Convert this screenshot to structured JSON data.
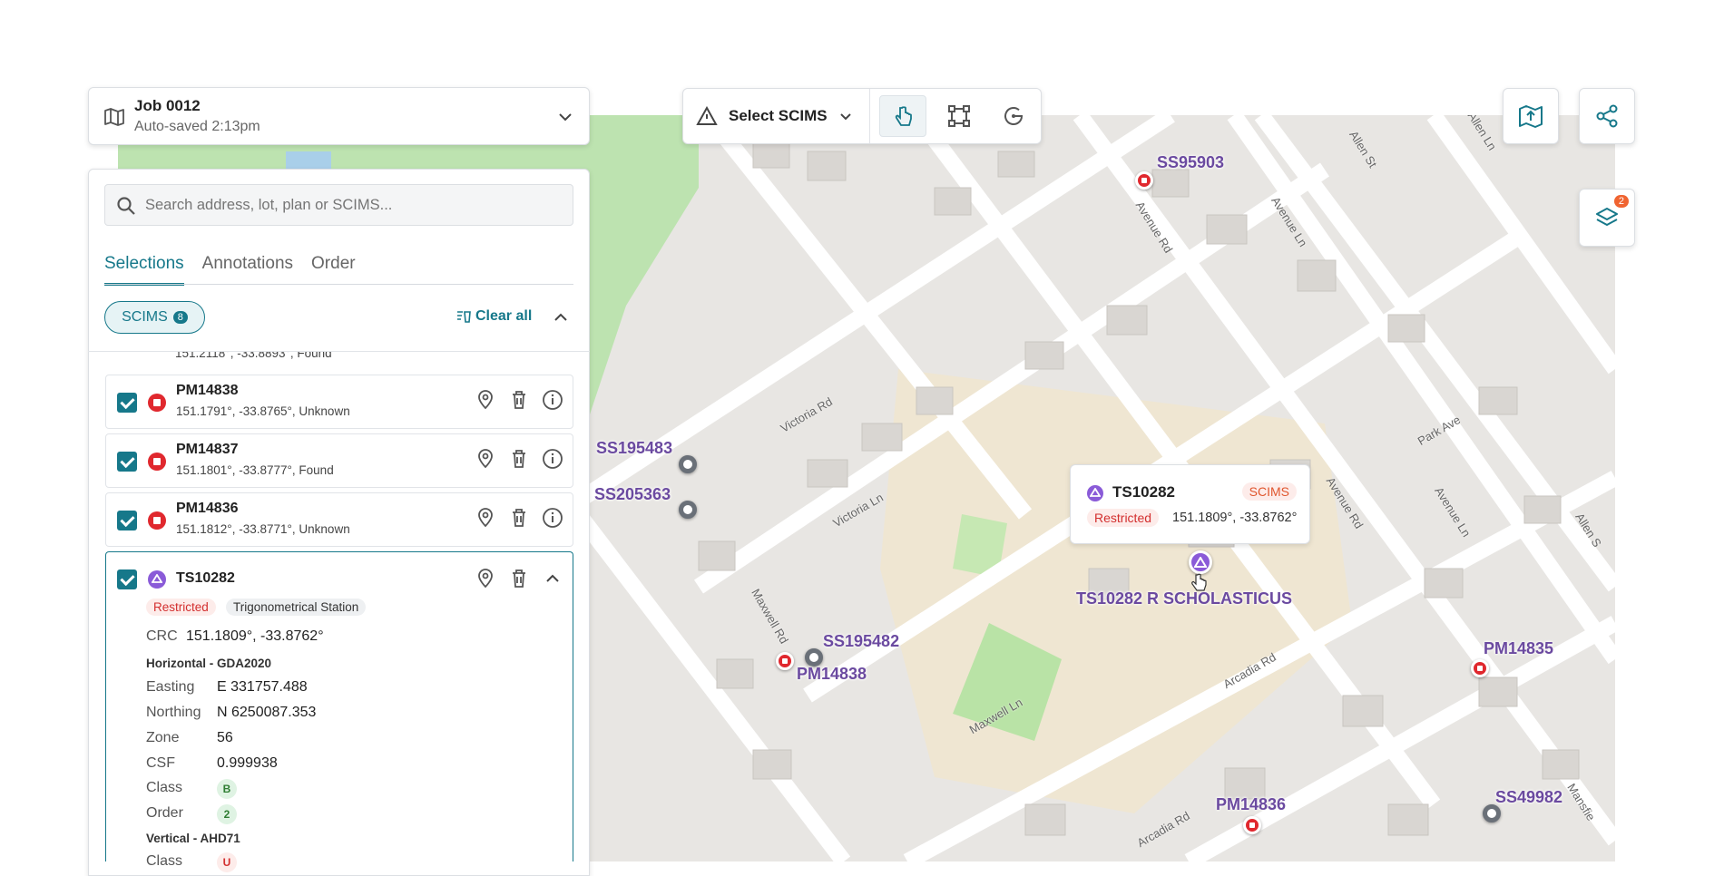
{
  "job": {
    "title": "Job 0012",
    "subtitle": "Auto-saved 2:13pm"
  },
  "toolbar": {
    "select_label": "Select SCIMS"
  },
  "layers": {
    "badge": "2"
  },
  "search": {
    "placeholder": "Search address, lot, plan or SCIMS..."
  },
  "tabs": [
    {
      "label": "Selections"
    },
    {
      "label": "Annotations"
    },
    {
      "label": "Order"
    }
  ],
  "filter": {
    "chip_label": "SCIMS",
    "chip_count": "8",
    "clear_all": "Clear all"
  },
  "partial_row": {
    "sub": "151.2118°, -33.8893°, Found"
  },
  "rows": [
    {
      "name": "PM14838",
      "coords": "151.1791°, -33.8765°,",
      "status": "Unknown"
    },
    {
      "name": "PM14837",
      "coords": "151.1801°, -33.8777°,",
      "status": "Found"
    },
    {
      "name": "PM14836",
      "coords": "151.1812°, -33.8771°,",
      "status": "Unknown"
    }
  ],
  "expanded": {
    "name": "TS10282",
    "badge_restricted": "Restricted",
    "badge_type": "Trigonometrical Station",
    "crc_label": "CRC",
    "crc_value": "151.1809°, -33.8762°",
    "horizontal_title": "Horizontal - GDA2020",
    "easting_label": "Easting",
    "easting_value": "E 331757.488",
    "northing_label": "Northing",
    "northing_value": "N 6250087.353",
    "zone_label": "Zone",
    "zone_value": "56",
    "csf_label": "CSF",
    "csf_value": "0.999938",
    "class_label": "Class",
    "class_value": "B",
    "order_label": "Order",
    "order_value": "2",
    "vertical_title": "Vertical - AHD71",
    "vclass_label": "Class",
    "vclass_value": "U"
  },
  "popup": {
    "name": "TS10282",
    "tag": "SCIMS",
    "restricted": "Restricted",
    "coords": "151.1809°, -33.8762°"
  },
  "map_labels": {
    "ss95903": "SS95903",
    "ss195483": "SS195483",
    "ss205363": "SS205363",
    "ss195482": "SS195482",
    "pm14838": "PM14838",
    "pm14835": "PM14835",
    "pm14836": "PM14836",
    "ss49982": "SS49982",
    "ts10282": "TS10282 R SCHOLASTICUS"
  },
  "streets": {
    "victoria_rd": "Victoria Rd",
    "victoria_ln": "Victoria Ln",
    "maxwell_rd": "Maxwell Rd",
    "maxwell_ln": "Maxwell Ln",
    "arcadia_rd": "Arcadia Rd",
    "arcadia_rd2": "Arcadia Rd",
    "avenue_rd": "Avenue Rd",
    "avenue_rd2": "Avenue Rd",
    "avenue_ln": "Avenue Ln",
    "avenue_ln2": "Avenue Ln",
    "allen_st": "Allen St",
    "allen_ln": "Allen Ln",
    "park_ave": "Park Ave",
    "allen_s": "Allen S",
    "mansfield": "Mansfie"
  },
  "colors": {
    "accent": "#16788a",
    "restricted": "#d32f2f",
    "purple": "#8a5bd8"
  }
}
